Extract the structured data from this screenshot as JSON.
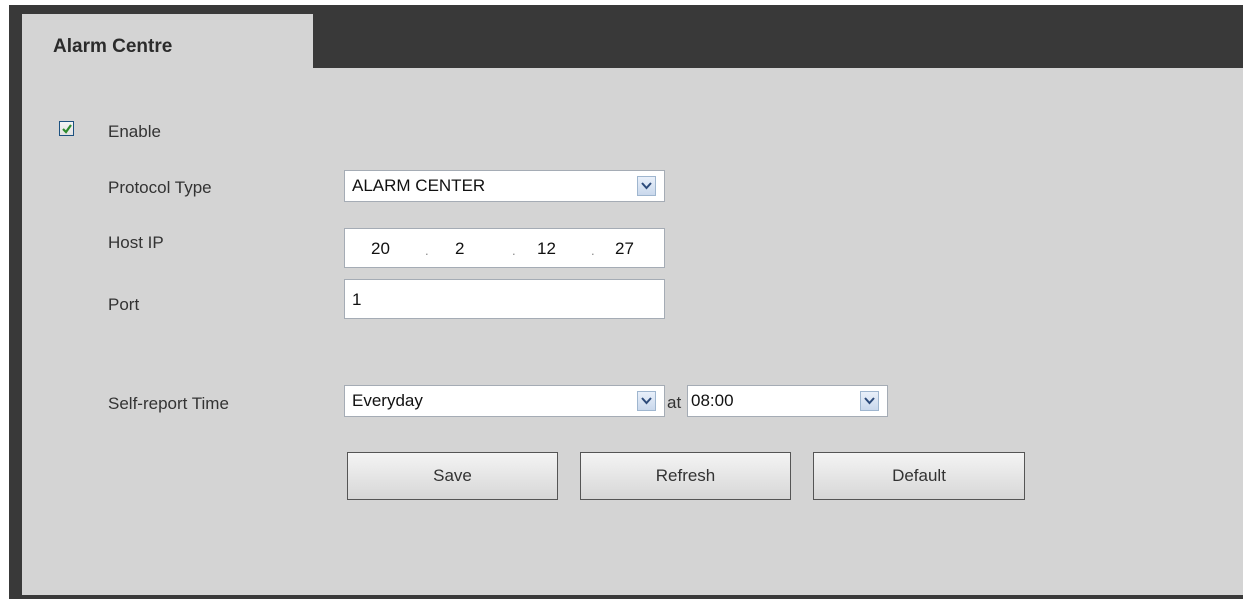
{
  "tab": {
    "label": "Alarm Centre"
  },
  "enable": {
    "label": "Enable",
    "checked": true
  },
  "protocol_type": {
    "label": "Protocol Type",
    "value": "ALARM CENTER"
  },
  "host_ip": {
    "label": "Host IP",
    "octets": [
      "20",
      "2",
      "12",
      "27"
    ]
  },
  "port": {
    "label": "Port",
    "value": "1"
  },
  "self_report": {
    "label": "Self-report Time",
    "period": "Everyday",
    "at_label": "at",
    "time": "08:00"
  },
  "buttons": {
    "save": "Save",
    "refresh": "Refresh",
    "default": "Default"
  },
  "colors": {
    "frame": "#393939",
    "panel": "#d4d4d4",
    "check": "#2e8b2e"
  }
}
